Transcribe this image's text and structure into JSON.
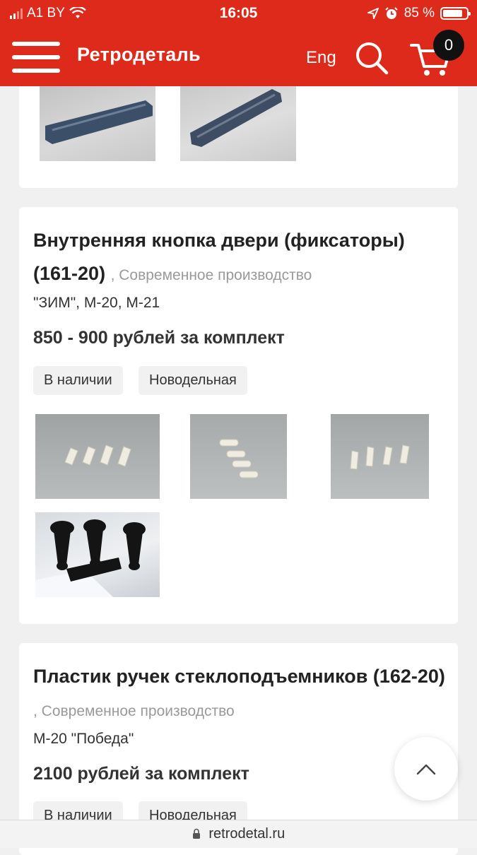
{
  "status": {
    "carrier": "A1 BY",
    "time": "16:05",
    "battery": "85 %",
    "battery_level": 0.85
  },
  "header": {
    "brand": "Ретродеталь",
    "lang": "Eng",
    "cart_count": "0"
  },
  "products": [
    {
      "title": "Внутренняя кнопка двери (фиксаторы) (161-20)",
      "subtitle": ", Современное производство",
      "models": "\"ЗИМ\", М-20, М-21",
      "price": "850 - 900 рублей за комплект",
      "tags": [
        "В наличии",
        "Новодельная"
      ]
    },
    {
      "title": "Пластик ручек стеклоподъемников (162-20)",
      "subtitle": ", Современное производство",
      "models": "М-20 \"Победа\"",
      "price": "2100 рублей за комплект",
      "tags": [
        "В наличии",
        "Новодельная"
      ]
    }
  ],
  "footer": {
    "url": "retrodetal.ru"
  },
  "icons": [
    "signal-icon",
    "wifi-icon",
    "location-icon",
    "alarm-icon",
    "battery-icon",
    "menu-icon",
    "search-icon",
    "cart-icon",
    "lock-icon",
    "chevron-up-icon"
  ],
  "colors": {
    "brand": "#dd2a1b",
    "badge": "#111111"
  }
}
